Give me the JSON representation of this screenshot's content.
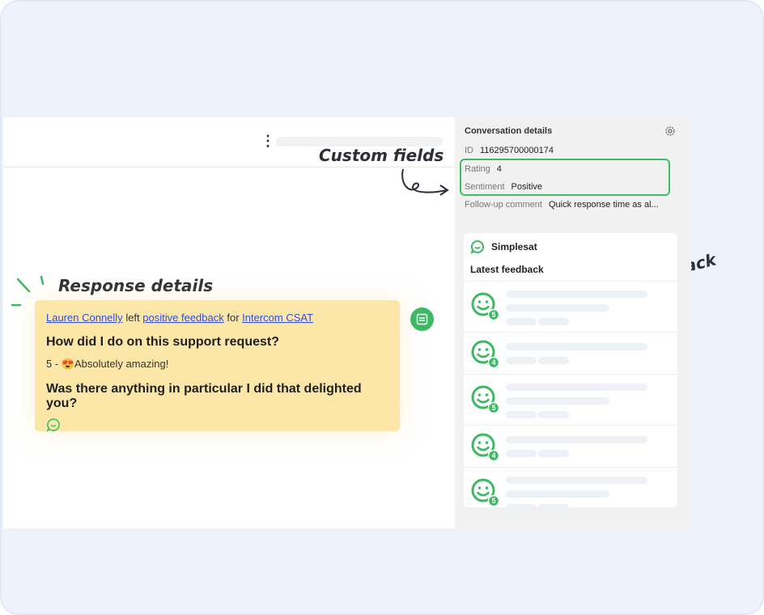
{
  "annotations": {
    "custom_fields": "Custom fields",
    "response_details": "Response details",
    "latest_feedback": "Latest feedback"
  },
  "response": {
    "author": "Lauren Connelly",
    "verb": "left",
    "feedback_link": "positive feedback",
    "prep": "for",
    "survey": "Intercom CSAT",
    "question1": "How did I do on this support request?",
    "answer1": "5 - 😍Absolutely amazing!",
    "question2": "Was there anything in particular I did that delighted you?"
  },
  "conversation": {
    "title": "Conversation details",
    "id_label": "ID",
    "id_value": "116295700000174",
    "rating_label": "Rating",
    "rating_value": "4",
    "sentiment_label": "Sentiment",
    "sentiment_value": "Positive",
    "followup_label": "Follow-up comment",
    "followup_value": "Quick response time as al..."
  },
  "simplesat": {
    "name": "Simplesat",
    "section": "Latest feedback",
    "items": [
      {
        "score": "5"
      },
      {
        "score": "4"
      },
      {
        "score": "5"
      },
      {
        "score": "4"
      },
      {
        "score": "5"
      }
    ]
  },
  "colors": {
    "accent": "#3cb962",
    "highlight_border": "#3cbf64",
    "card_bg": "#fde7a8",
    "link": "#2f4de0"
  }
}
